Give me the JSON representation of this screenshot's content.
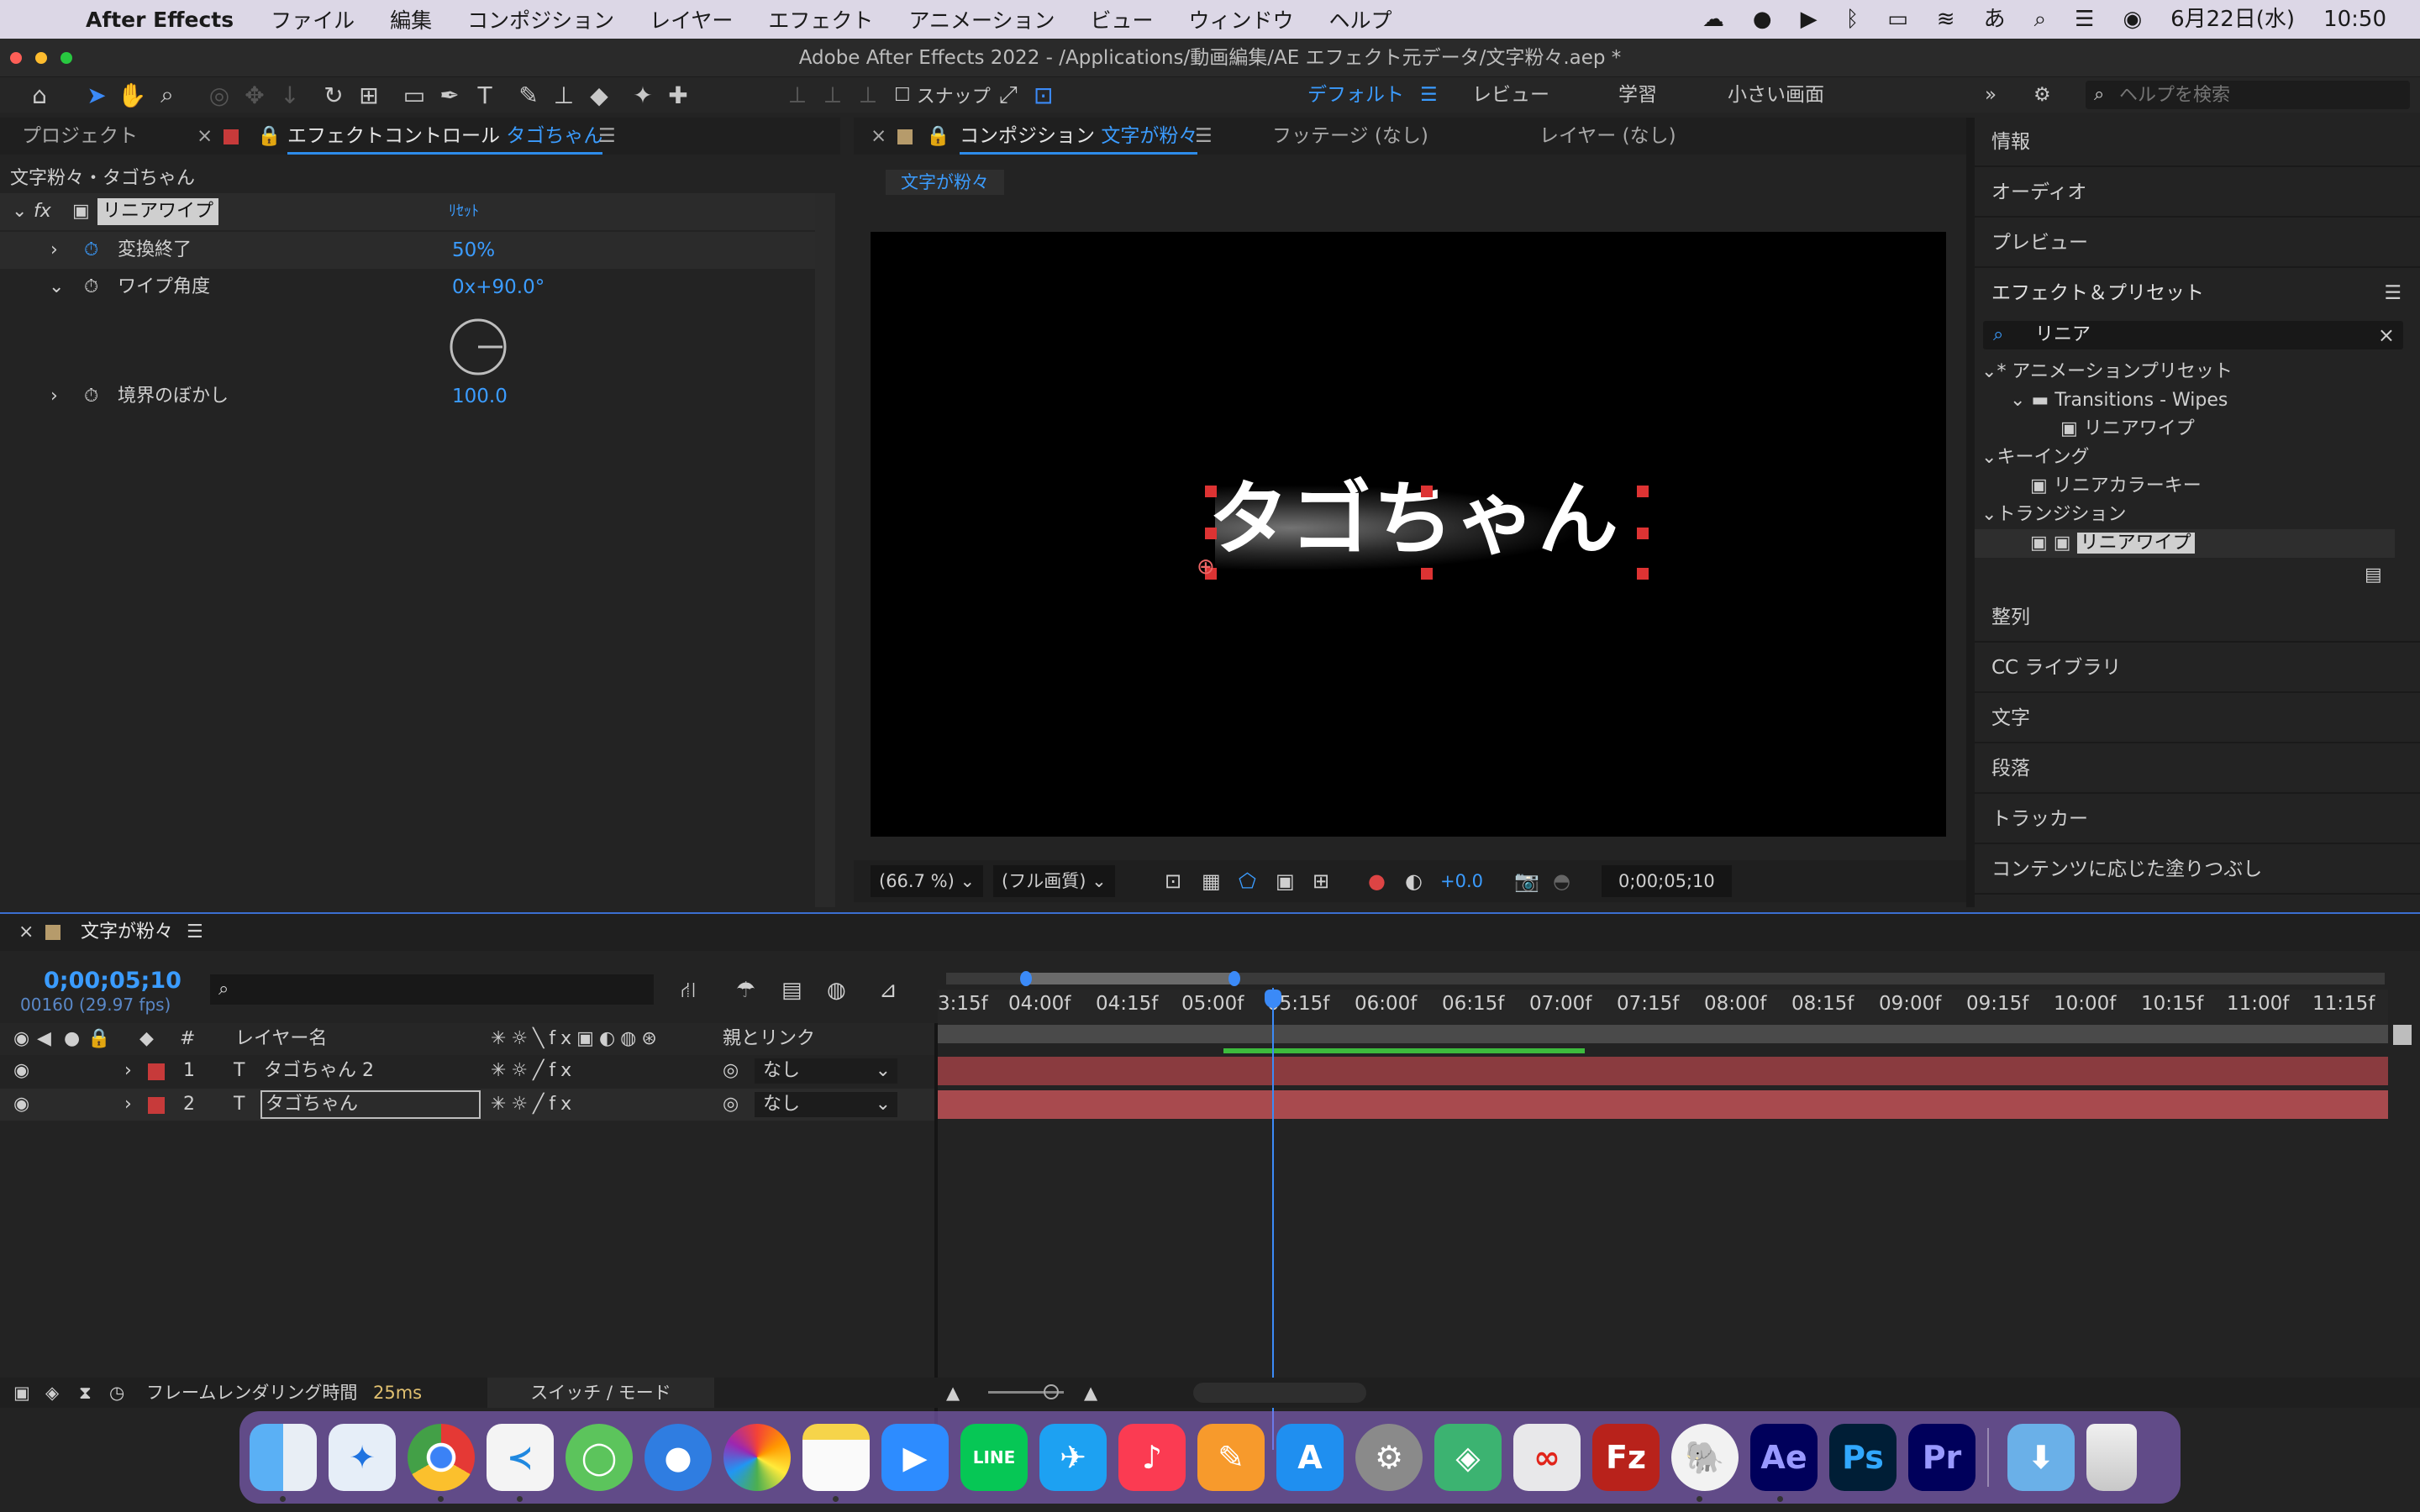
{
  "menubar": {
    "app_name": "After Effects",
    "items": [
      "ファイル",
      "編集",
      "コンポジション",
      "レイヤー",
      "エフェクト",
      "アニメーション",
      "ビュー",
      "ウィンドウ",
      "ヘルプ"
    ],
    "date": "6月22日(水)",
    "time": "10:50",
    "input_method": "あ"
  },
  "window": {
    "title": "Adobe After Effects 2022 - /Applications/動画編集/AE エフェクト元データ/文字粉々.aep *"
  },
  "toolbar": {
    "snap_label": "スナップ",
    "workspaces": [
      "デフォルト",
      "レビュー",
      "学習",
      "小さい画面"
    ],
    "help_search_placeholder": "ヘルプを検索"
  },
  "left_panel": {
    "tab_project": "プロジェクト",
    "tab_effect_controls": "エフェクトコントロール",
    "tab_effect_layer": "タゴちゃん",
    "breadcrumb": "文字粉々・タゴちゃん",
    "effect_name": "リニアワイプ",
    "reset_label": "ﾘｾｯﾄ",
    "params": [
      {
        "label": "変換終了",
        "value": "50%"
      },
      {
        "label": "ワイプ角度",
        "value": "0x+90.0°"
      },
      {
        "label": "境界のぼかし",
        "value": "100.0"
      }
    ]
  },
  "comp_panel": {
    "tab_comp_prefix": "コンポジション",
    "tab_comp_name": "文字が粉々",
    "tab_footage": "フッテージ (なし)",
    "tab_layer": "レイヤー (なし)",
    "subtab": "文字が粉々",
    "canvas_text": "タゴちゃん",
    "zoom": "(66.7 %)",
    "quality": "(フル画質)",
    "exposure": "+0.0",
    "timecode": "0;00;05;10"
  },
  "right_panel": {
    "sections_top": [
      "情報",
      "オーディオ",
      "プレビュー"
    ],
    "effects_title": "エフェクト＆プリセット",
    "search_value": "リニア",
    "tree": [
      {
        "label": "* アニメーションプリセット",
        "level": 0
      },
      {
        "label": "Transitions - Wipes",
        "level": 1
      },
      {
        "label": "リニアワイプ",
        "level": 2
      },
      {
        "label": "キーイング",
        "level": 0
      },
      {
        "label": "リニアカラーキー",
        "level": 2
      },
      {
        "label": "トランジション",
        "level": 0
      },
      {
        "label": "リニアワイプ",
        "level": 2
      }
    ],
    "sections_bottom": [
      "整列",
      "CC ライブラリ",
      "文字",
      "段落",
      "トラッカー",
      "コンテンツに応じた塗りつぶし"
    ]
  },
  "timeline": {
    "comp_name": "文字が粉々",
    "timecode": "0;00;05;10",
    "frame_info": "00160 (29.97 fps)",
    "col_layer_name": "レイヤー名",
    "col_parent": "親とリンク",
    "col_number": "#",
    "ruler_labels": [
      "3:15f",
      "04:00f",
      "04:15f",
      "05:00f",
      "05:15f",
      "06:00f",
      "06:15f",
      "07:00f",
      "07:15f",
      "08:00f",
      "08:15f",
      "09:00f",
      "09:15f",
      "10:00f",
      "10:15f",
      "11:00f",
      "11:15f"
    ],
    "layers": [
      {
        "num": "1",
        "name": "タゴちゃん 2",
        "parent": "なし"
      },
      {
        "num": "2",
        "name": "タゴちゃん",
        "parent": "なし"
      }
    ],
    "render_time_label": "フレームレンダリング時間",
    "render_time_value": "25ms",
    "switch_mode": "スイッチ / モード"
  },
  "dock": {
    "apps": [
      "finder-icon",
      "safari-icon",
      "chrome-icon",
      "vscode-icon",
      "app5-icon",
      "maps-icon",
      "photos-icon",
      "notes-icon",
      "zoom-icon",
      "line-icon",
      "twitter-icon",
      "music-icon",
      "pages-icon",
      "appstore-icon",
      "settings-icon",
      "app16-icon",
      "creative-cloud-icon",
      "filezilla-icon",
      "tableplus-icon",
      "ae-icon",
      "ps-icon",
      "pr-icon",
      "downloads-icon",
      "trash-icon"
    ],
    "labels": {
      "ae": "Ae",
      "ps": "Ps",
      "pr": "Pr",
      "fz": "Fz",
      "line": "LINE"
    }
  }
}
